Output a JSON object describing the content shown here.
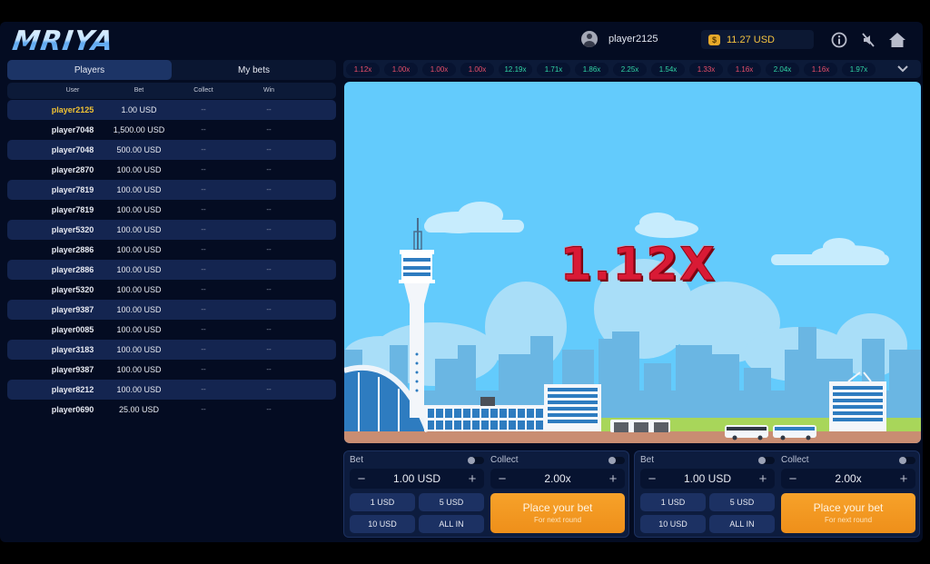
{
  "header": {
    "logo": "MRIYA",
    "username": "player2125",
    "balance": "11.27 USD",
    "icons": [
      "info-icon",
      "sound-muted-icon",
      "home-icon"
    ]
  },
  "left_panel": {
    "tabs": [
      {
        "label": "Players",
        "active": true
      },
      {
        "label": "My bets",
        "active": false
      }
    ],
    "columns": [
      "User",
      "Bet",
      "Collect",
      "Win"
    ],
    "rows": [
      {
        "user": "player2125",
        "bet": "1.00 USD",
        "collect": "--",
        "win": "--",
        "is_current_user": true
      },
      {
        "user": "player7048",
        "bet": "1,500.00 USD",
        "collect": "--",
        "win": "--"
      },
      {
        "user": "player7048",
        "bet": "500.00 USD",
        "collect": "--",
        "win": "--"
      },
      {
        "user": "player2870",
        "bet": "100.00 USD",
        "collect": "--",
        "win": "--"
      },
      {
        "user": "player7819",
        "bet": "100.00 USD",
        "collect": "--",
        "win": "--"
      },
      {
        "user": "player7819",
        "bet": "100.00 USD",
        "collect": "--",
        "win": "--"
      },
      {
        "user": "player5320",
        "bet": "100.00 USD",
        "collect": "--",
        "win": "--"
      },
      {
        "user": "player2886",
        "bet": "100.00 USD",
        "collect": "--",
        "win": "--"
      },
      {
        "user": "player2886",
        "bet": "100.00 USD",
        "collect": "--",
        "win": "--"
      },
      {
        "user": "player5320",
        "bet": "100.00 USD",
        "collect": "--",
        "win": "--"
      },
      {
        "user": "player9387",
        "bet": "100.00 USD",
        "collect": "--",
        "win": "--"
      },
      {
        "user": "player0085",
        "bet": "100.00 USD",
        "collect": "--",
        "win": "--"
      },
      {
        "user": "player3183",
        "bet": "100.00 USD",
        "collect": "--",
        "win": "--"
      },
      {
        "user": "player9387",
        "bet": "100.00 USD",
        "collect": "--",
        "win": "--"
      },
      {
        "user": "player8212",
        "bet": "100.00 USD",
        "collect": "--",
        "win": "--"
      },
      {
        "user": "player0690",
        "bet": "25.00 USD",
        "collect": "--",
        "win": "--"
      }
    ]
  },
  "history": [
    {
      "value": "1.12x",
      "status": "red"
    },
    {
      "value": "1.00x",
      "status": "red"
    },
    {
      "value": "1.00x",
      "status": "red"
    },
    {
      "value": "1.00x",
      "status": "red"
    },
    {
      "value": "12.19x",
      "status": "green"
    },
    {
      "value": "1.71x",
      "status": "green"
    },
    {
      "value": "1.86x",
      "status": "green"
    },
    {
      "value": "2.25x",
      "status": "green"
    },
    {
      "value": "1.54x",
      "status": "green"
    },
    {
      "value": "1.33x",
      "status": "red"
    },
    {
      "value": "1.16x",
      "status": "red"
    },
    {
      "value": "2.04x",
      "status": "green"
    },
    {
      "value": "1.16x",
      "status": "red"
    },
    {
      "value": "1.97x",
      "status": "green"
    }
  ],
  "game": {
    "multiplier": "1.12X"
  },
  "bet_panels": [
    {
      "bet_label": "Bet",
      "bet_value": "1.00 USD",
      "collect_label": "Collect",
      "collect_value": "2.00x",
      "quick_bets": [
        "1 USD",
        "5 USD",
        "10 USD",
        "ALL IN"
      ],
      "place_button": "Place your bet",
      "place_sub": "For next round"
    },
    {
      "bet_label": "Bet",
      "bet_value": "1.00 USD",
      "collect_label": "Collect",
      "collect_value": "2.00x",
      "quick_bets": [
        "1 USD",
        "5 USD",
        "10 USD",
        "ALL IN"
      ],
      "place_button": "Place your bet",
      "place_sub": "For next round"
    }
  ],
  "colors": {
    "accent_orange": "#f29a22",
    "crash_red": "#ea4f6a",
    "win_green": "#31d5a6",
    "highlight_user": "#f2c334",
    "sky": "#63cbfc"
  }
}
